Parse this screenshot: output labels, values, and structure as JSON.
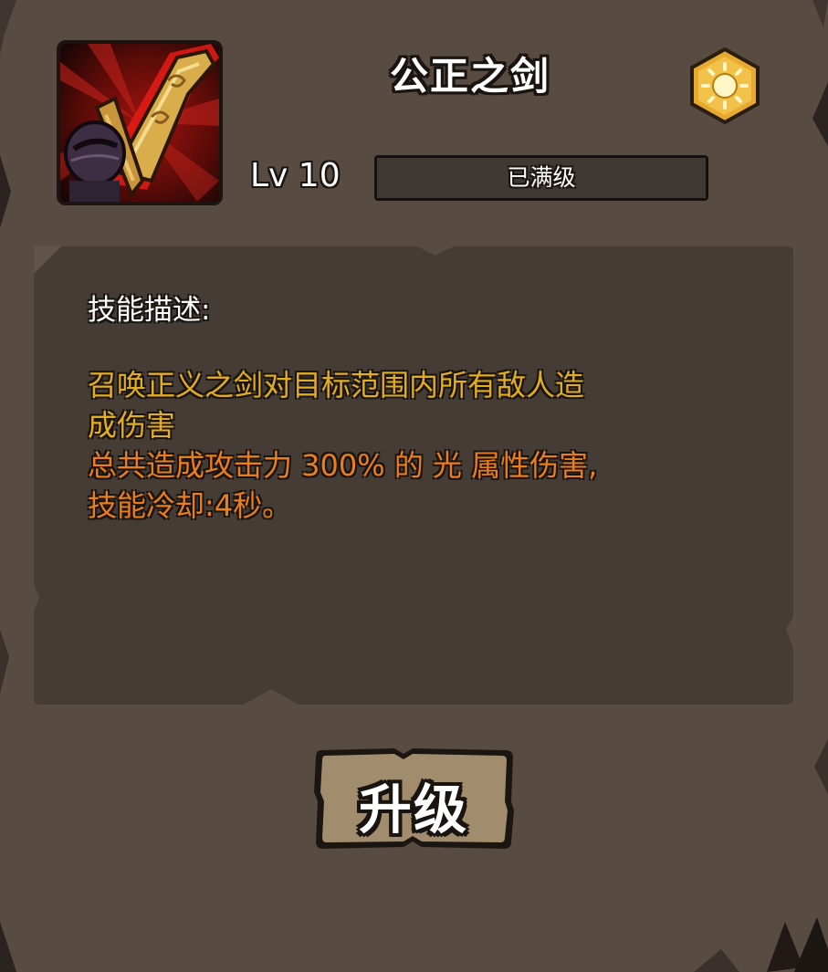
{
  "skill": {
    "name": "公正之剑",
    "element_icon": "sun-icon",
    "level_label": "Lv 10",
    "level_status": "已满级",
    "level_progress": 1.0
  },
  "description": {
    "heading": "技能描述:",
    "lines": [
      {
        "text": "召唤正义之剑对目标范围内所有敌人造",
        "color": "#e3ad21"
      },
      {
        "text": "成伤害",
        "color": "#e3ad21"
      },
      {
        "text": "总共造成攻击力 300% 的 光 属性伤害,",
        "color": "#ea7d1c"
      },
      {
        "text": "技能冷却:4秒。",
        "color": "#ea7d1c"
      }
    ]
  },
  "actions": {
    "upgrade_label": "升级"
  },
  "colors": {
    "panel_bg": "#574b42",
    "desc_bg": "#453c36",
    "button_bg": "#a28c6e",
    "element_gold": "#e7a92f"
  }
}
